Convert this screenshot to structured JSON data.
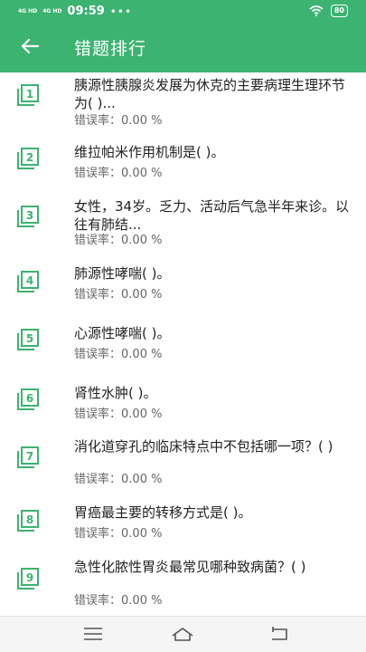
{
  "status": {
    "signal1": "4G HD",
    "signal2": "4G HD",
    "time": "09:59",
    "dots": "•••",
    "battery": "80"
  },
  "header": {
    "title": "错题排行",
    "back_icon": "arrow-left-icon"
  },
  "rate_label": "错误率：",
  "items": [
    {
      "num": "1",
      "question": "胰源性胰腺炎发展为休克的主要病理生理环节为( )...",
      "rate": "0.00 %"
    },
    {
      "num": "2",
      "question": "维拉帕米作用机制是( )。",
      "rate": "0.00 %"
    },
    {
      "num": "3",
      "question": "女性，34岁。乏力、活动后气急半年来诊。以往有肺结...",
      "rate": "0.00 %"
    },
    {
      "num": "4",
      "question": "肺源性哮喘( )。",
      "rate": "0.00 %"
    },
    {
      "num": "5",
      "question": "心源性哮喘( )。",
      "rate": "0.00 %"
    },
    {
      "num": "6",
      "question": "肾性水肿( )。",
      "rate": "0.00 %"
    },
    {
      "num": "7",
      "question": "消化道穿孔的临床特点中不包括哪一项？( )",
      "rate": "0.00 %"
    },
    {
      "num": "8",
      "question": "胃癌最主要的转移方式是( )。",
      "rate": "0.00 %"
    },
    {
      "num": "9",
      "question": "急性化脓性胃炎最常见哪种致病菌？( )",
      "rate": "0.00 %"
    }
  ],
  "colors": {
    "accent": "#3cb371",
    "icon": "#3cb371",
    "rate_text": "#666666"
  }
}
